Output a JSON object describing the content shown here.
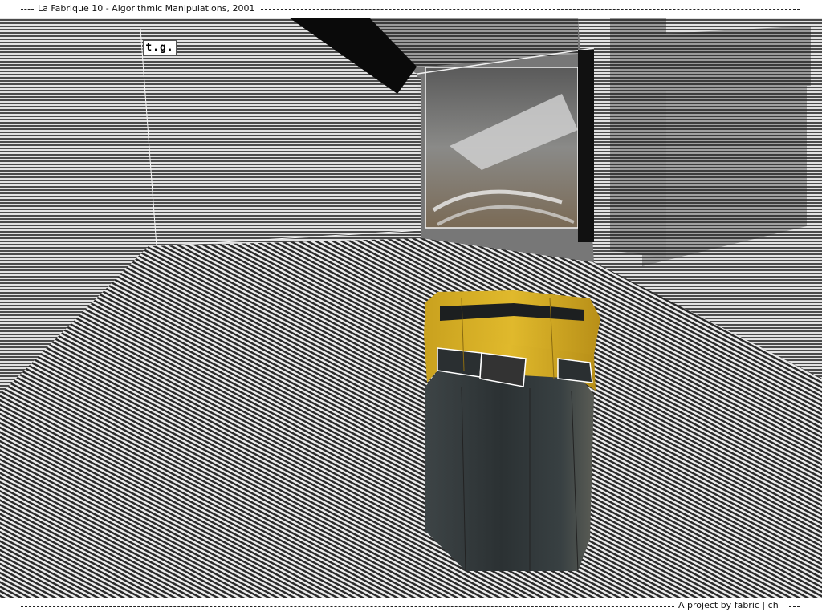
{
  "header": {
    "title": "La Fabrique 10 - Algorithmic Manipulations, 2001"
  },
  "scene": {
    "tag_label": "t.g.",
    "colors": {
      "wall_light": "#d9d9d9",
      "wall_dark": "#3a3a3a",
      "floor_light": "#e6e6e6",
      "floor_dark": "#2a2a2a",
      "bin_yellow": "#d4aa22",
      "bin_body": "#2e3436"
    }
  },
  "footer": {
    "credit_prefix": "A project by",
    "link_fabric": "fabric",
    "separator": " | ",
    "link_ch": "ch"
  }
}
